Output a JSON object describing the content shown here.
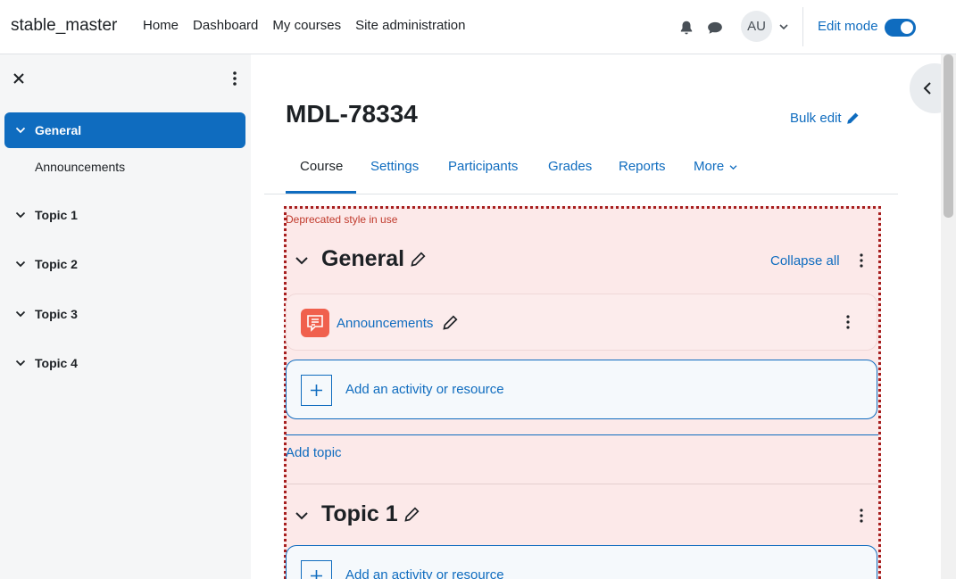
{
  "navbar": {
    "brand": "stable_master",
    "links": [
      "Home",
      "Dashboard",
      "My courses",
      "Site administration"
    ],
    "user_initials": "AU",
    "edit_mode_label": "Edit mode",
    "edit_mode_on": true
  },
  "drawer": {
    "items": [
      {
        "label": "General",
        "active": true
      },
      {
        "label": "Topic 1"
      },
      {
        "label": "Topic 2"
      },
      {
        "label": "Topic 3"
      },
      {
        "label": "Topic 4"
      }
    ],
    "subitems": [
      "Announcements"
    ]
  },
  "page": {
    "title": "MDL-78334",
    "bulk_edit": "Bulk edit"
  },
  "tabs": [
    "Course",
    "Settings",
    "Participants",
    "Grades",
    "Reports",
    "More"
  ],
  "course": {
    "deprecated_notice": "Deprecated style in use",
    "collapse_all": "Collapse all",
    "sections": [
      {
        "title": "General",
        "activities": [
          {
            "name": "Announcements",
            "icon": "forum-icon"
          }
        ]
      },
      {
        "title": "Topic 1",
        "activities": []
      }
    ],
    "add_activity_label": "Add an activity or resource",
    "add_topic_label": "Add topic"
  },
  "colors": {
    "primary": "#0f6cbf",
    "deprecated_bg": "#fce9e9",
    "deprecated_border": "#a61e1e",
    "forum_icon_bg": "#f0604d"
  }
}
